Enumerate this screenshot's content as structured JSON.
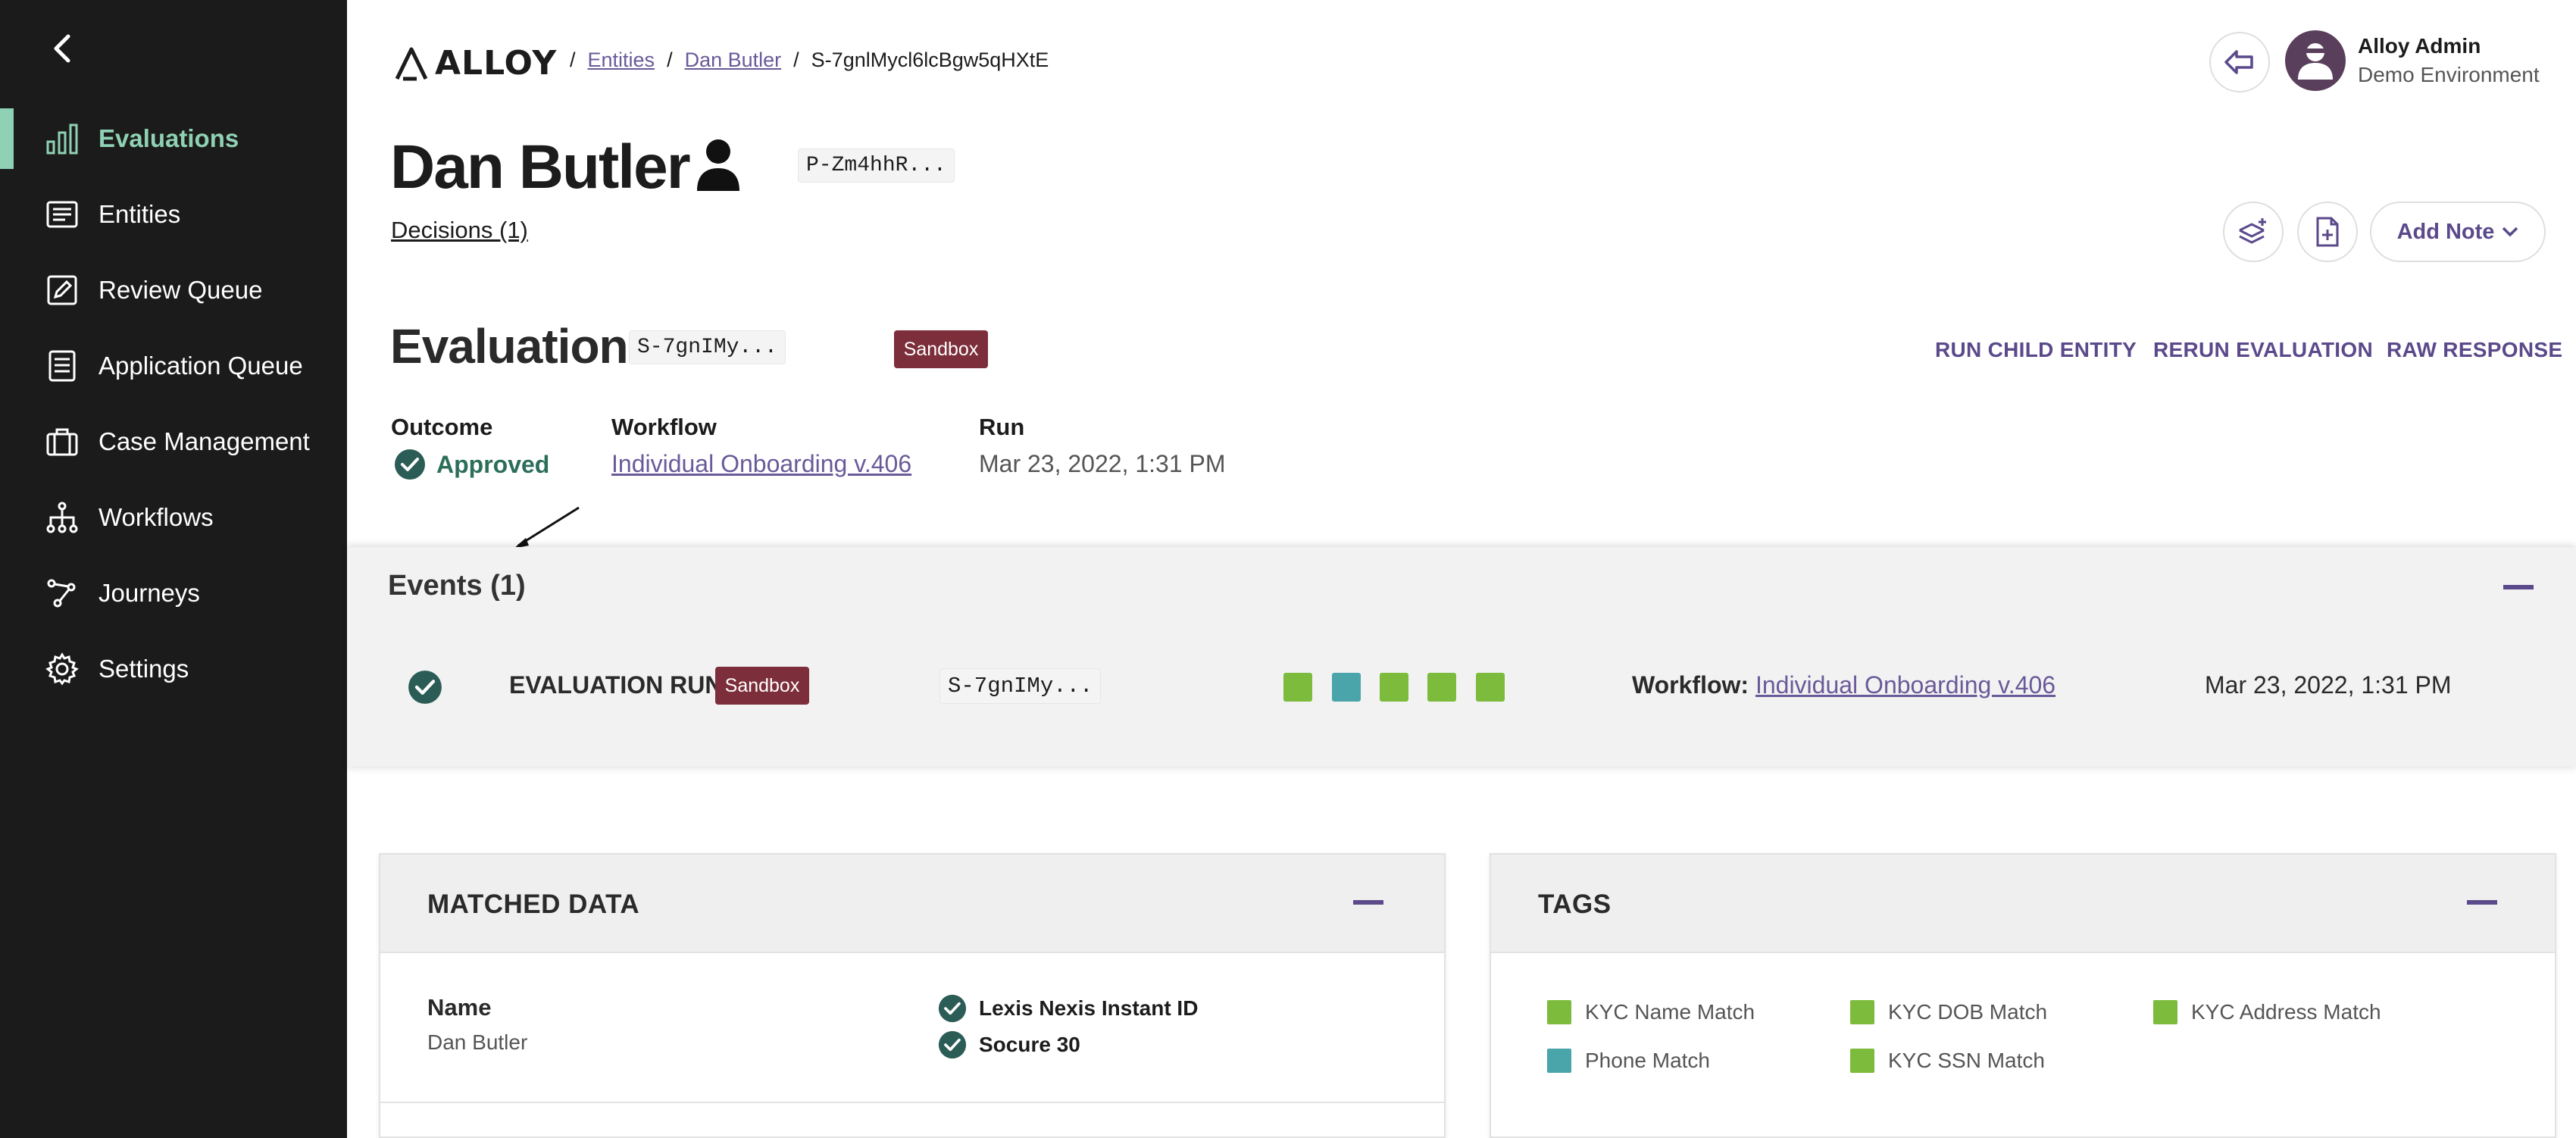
{
  "sidebar": {
    "back_icon": "chevron-left-icon",
    "accent": "#8fd1b4",
    "items": [
      {
        "label": "Evaluations",
        "icon": "bar-chart-icon",
        "active": true
      },
      {
        "label": "Entities",
        "icon": "list-card-icon"
      },
      {
        "label": "Review Queue",
        "icon": "edit-square-icon"
      },
      {
        "label": "Application Queue",
        "icon": "document-icon"
      },
      {
        "label": "Case Management",
        "icon": "briefcase-icon"
      },
      {
        "label": "Workflows",
        "icon": "workflow-tree-icon"
      },
      {
        "label": "Journeys",
        "icon": "journey-path-icon"
      },
      {
        "label": "Settings",
        "icon": "gear-icon"
      }
    ]
  },
  "header": {
    "logo_text": "ALLOY",
    "breadcrumb": {
      "sep": "/",
      "entities": "Entities",
      "entity": "Dan Butler",
      "current": "S-7gnlMycl6lcBgw5qHXtE"
    },
    "user": {
      "name": "Alloy Admin",
      "environment": "Demo Environment"
    }
  },
  "entity": {
    "name": "Dan Butler",
    "id_short": "P-Zm4hhR...",
    "decisions_link": "Decisions (1)",
    "add_note_label": "Add Note"
  },
  "evaluation": {
    "title": "Evaluation",
    "id_short": "S-7gnIMy...",
    "badge": "Sandbox",
    "actions": {
      "run_child": "RUN CHILD ENTITY",
      "rerun": "RERUN EVALUATION",
      "raw": "RAW RESPONSE"
    },
    "outcome_label": "Outcome",
    "outcome": "Approved",
    "workflow_label": "Workflow",
    "workflow": "Individual Onboarding v.406",
    "run_label": "Run",
    "run": "Mar 23, 2022, 1:31 PM"
  },
  "events": {
    "title": "Events (1)",
    "rows": [
      {
        "type": "EVALUATION RUN",
        "badge": "Sandbox",
        "id_short": "S-7gnIMy...",
        "tag_colors": [
          "#7dbb3c",
          "#4aa5ab",
          "#7dbb3c",
          "#7dbb3c",
          "#7dbb3c"
        ],
        "workflow_prefix": "Workflow:",
        "workflow": "Individual Onboarding v.406",
        "date": "Mar 23, 2022, 1:31 PM"
      }
    ]
  },
  "matched_data": {
    "title": "MATCHED DATA",
    "field_label": "Name",
    "field_value": "Dan Butler",
    "sources": [
      "Lexis Nexis Instant ID",
      "Socure 30"
    ]
  },
  "tags": {
    "title": "TAGS",
    "items": [
      {
        "label": "KYC Name Match",
        "color": "#7dbb3c"
      },
      {
        "label": "KYC DOB Match",
        "color": "#7dbb3c"
      },
      {
        "label": "KYC Address Match",
        "color": "#7dbb3c"
      },
      {
        "label": "Phone Match",
        "color": "#4aa5ab"
      },
      {
        "label": "KYC SSN Match",
        "color": "#7dbb3c"
      }
    ]
  },
  "colors": {
    "brand_purple": "#5b4a8b",
    "link": "#6a5a99",
    "badge": "#7c2e3a",
    "approved": "#2c6e5a"
  }
}
